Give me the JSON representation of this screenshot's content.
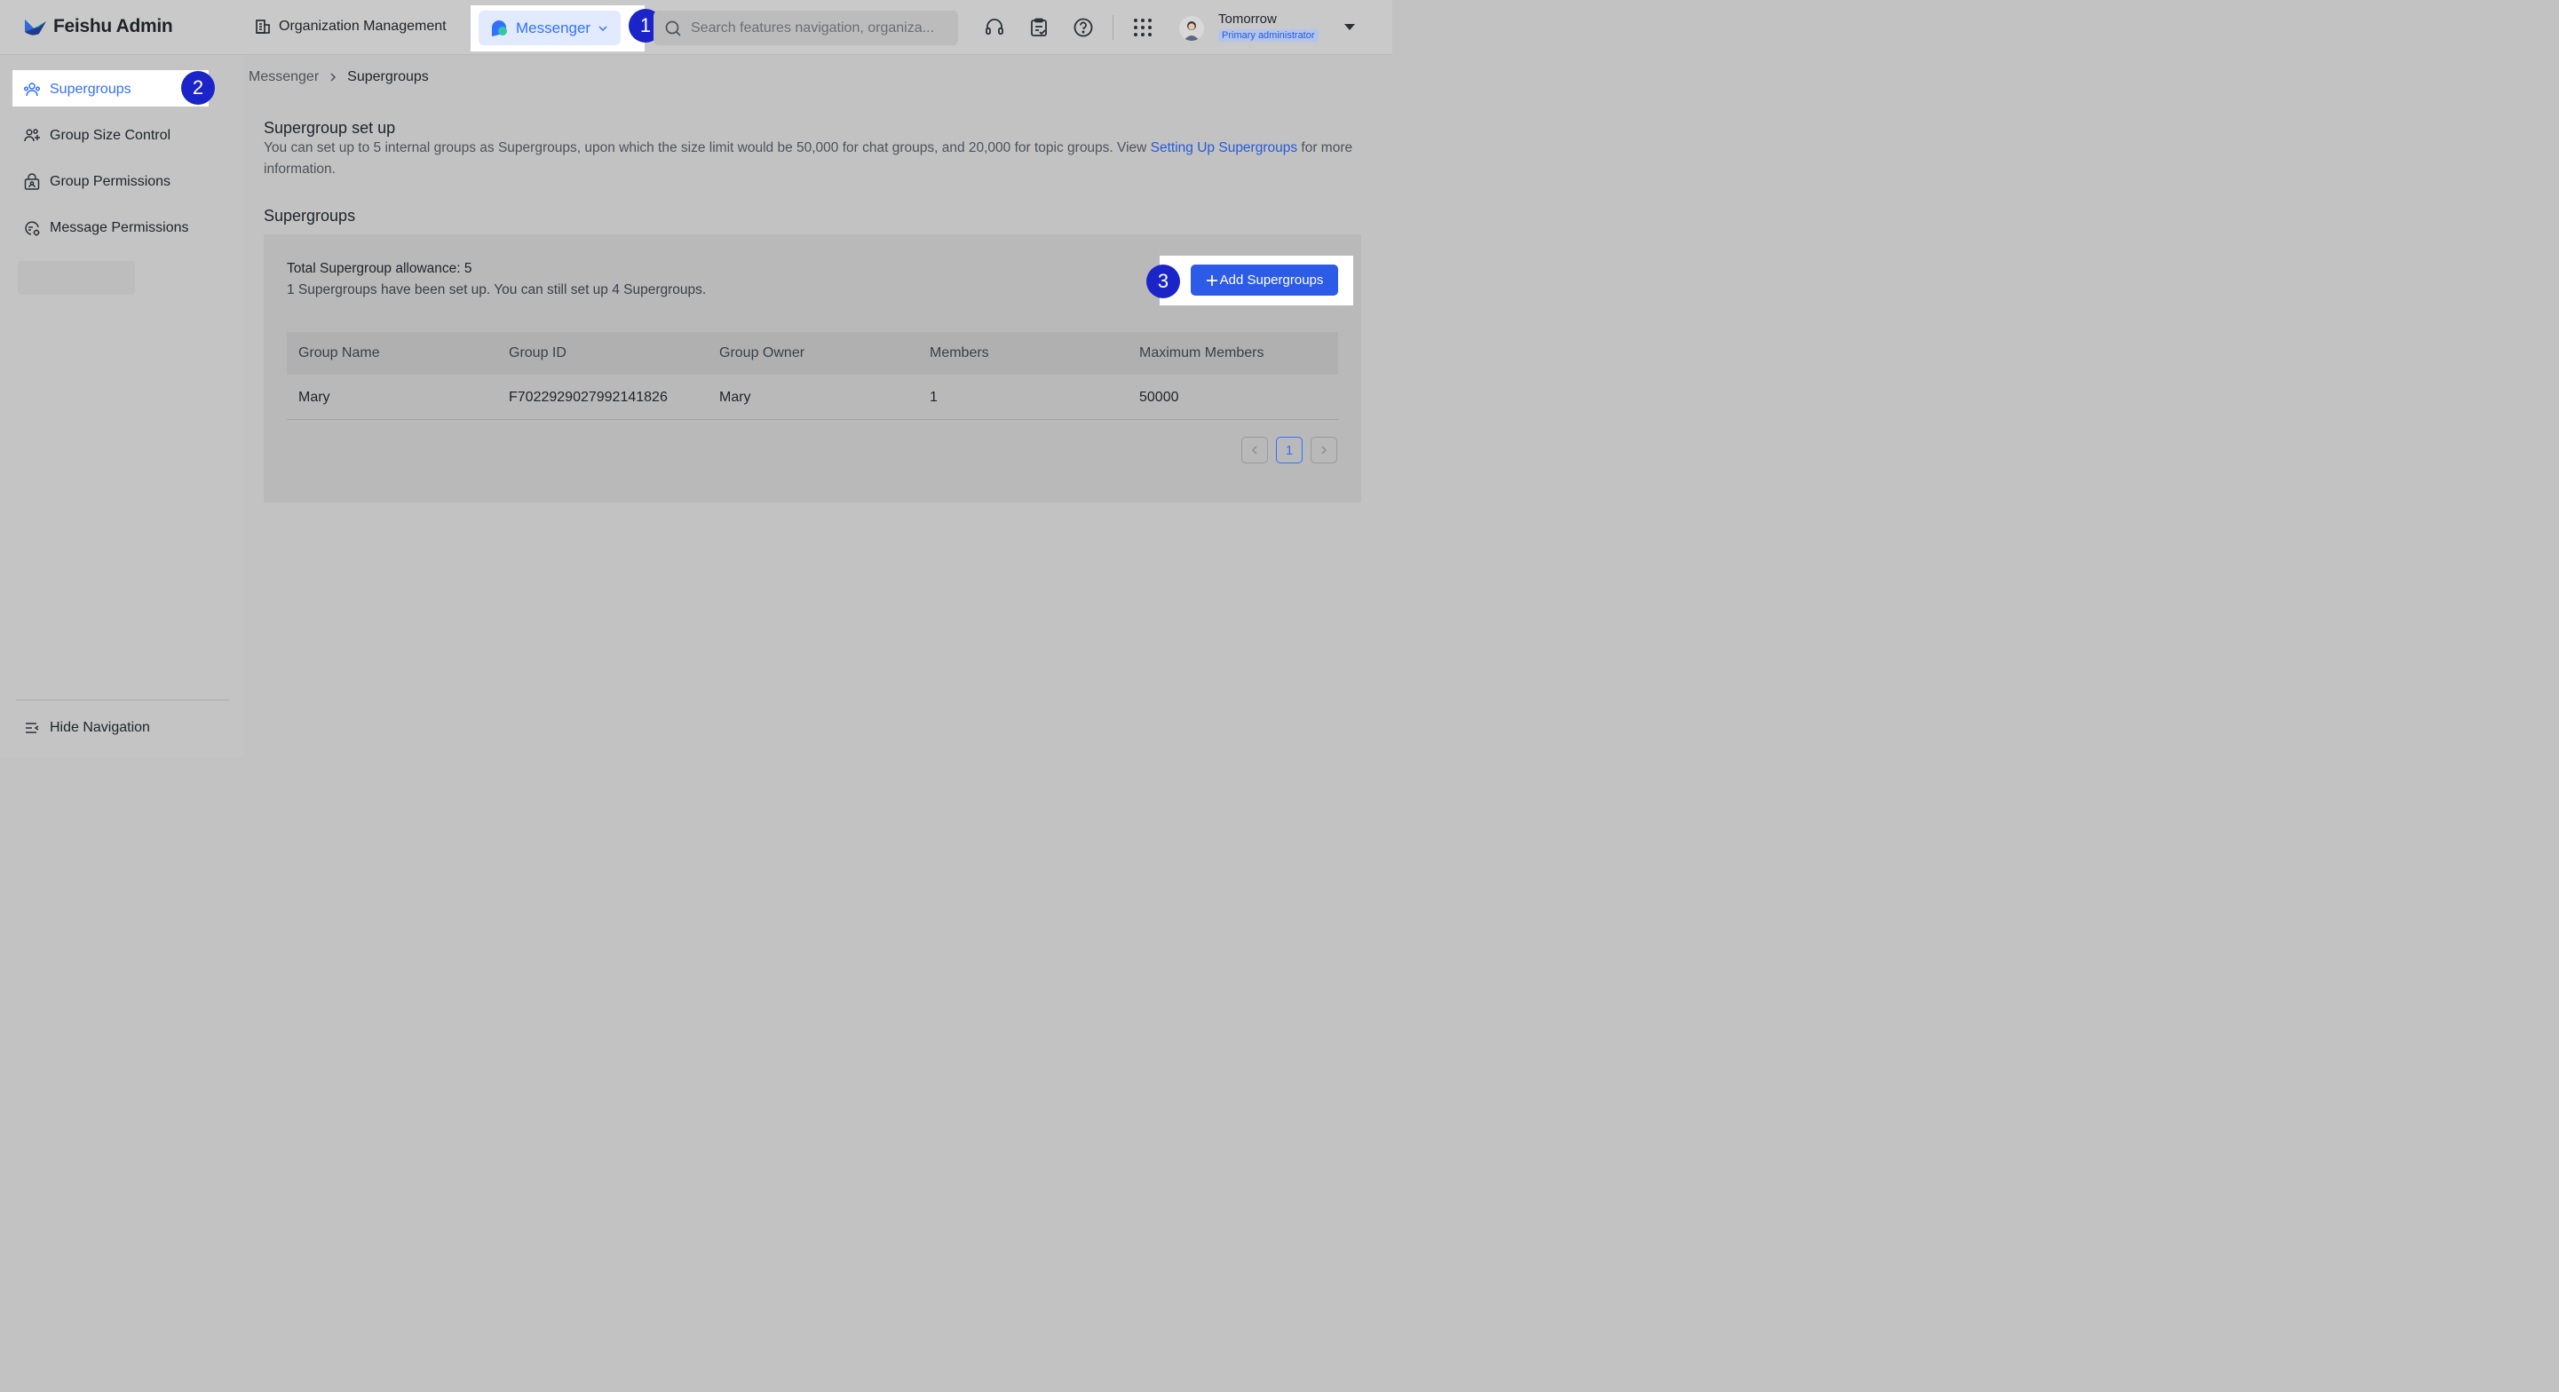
{
  "brand": {
    "name": "Feishu Admin"
  },
  "topbar": {
    "org_management": "Organization Management",
    "messenger_tab": "Messenger",
    "search_placeholder": "Search features navigation, organiza...",
    "user": {
      "name": "Tomorrow",
      "role": "Primary administrator"
    }
  },
  "badges": [
    "1",
    "2",
    "3"
  ],
  "sidebar": {
    "items": [
      {
        "label": "Supergroups",
        "icon": "supergroup-icon",
        "active": true
      },
      {
        "label": "Group Size Control",
        "icon": "group-size-icon"
      },
      {
        "label": "Group Permissions",
        "icon": "lock-group-icon"
      },
      {
        "label": "Message Permissions",
        "icon": "message-permission-icon"
      }
    ],
    "hide_nav": "Hide Navigation"
  },
  "breadcrumb": {
    "parent": "Messenger",
    "current": "Supergroups"
  },
  "setup": {
    "title": "Supergroup set up",
    "desc_before": "You can set up to 5 internal groups as Supergroups, upon which the size limit would be 50,000 for chat groups, and 20,000 for topic groups. View ",
    "desc_link": "Setting Up Supergroups",
    "desc_after": " for more information."
  },
  "supergroups": {
    "title": "Supergroups",
    "allowance": "Total Supergroup allowance: 5",
    "status": "1 Supergroups have been set up. You can still set up 4 Supergroups.",
    "add_button": "Add Supergroups",
    "columns": [
      "Group Name",
      "Group ID",
      "Group Owner",
      "Members",
      "Maximum Members"
    ],
    "rows": [
      [
        "Mary",
        "F7022929027992141826",
        "Mary",
        "1",
        "50000"
      ]
    ],
    "page": "1"
  },
  "colors": {
    "accent": "#3370ff",
    "button": "#2c5be8",
    "badge": "#1a24c9"
  }
}
